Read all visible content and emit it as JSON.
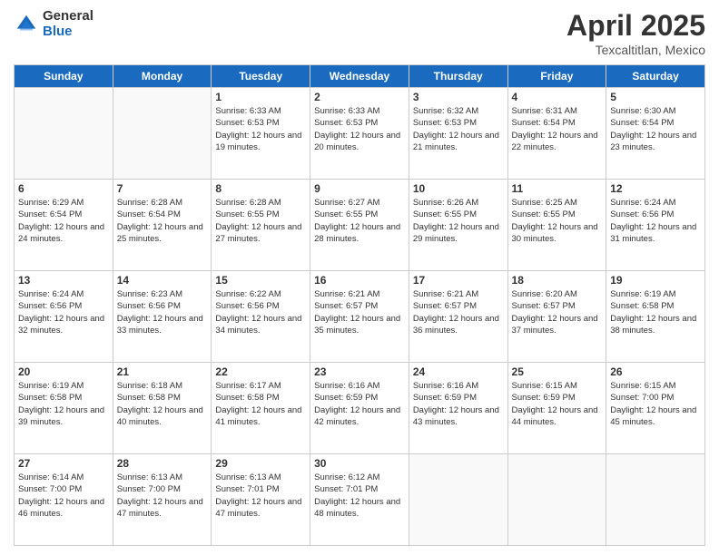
{
  "header": {
    "logo_general": "General",
    "logo_blue": "Blue",
    "month_title": "April 2025",
    "location": "Texcaltitlan, Mexico"
  },
  "weekdays": [
    "Sunday",
    "Monday",
    "Tuesday",
    "Wednesday",
    "Thursday",
    "Friday",
    "Saturday"
  ],
  "weeks": [
    [
      {
        "day": "",
        "info": ""
      },
      {
        "day": "",
        "info": ""
      },
      {
        "day": "1",
        "sunrise": "6:33 AM",
        "sunset": "6:53 PM",
        "daylight": "12 hours and 19 minutes."
      },
      {
        "day": "2",
        "sunrise": "6:33 AM",
        "sunset": "6:53 PM",
        "daylight": "12 hours and 20 minutes."
      },
      {
        "day": "3",
        "sunrise": "6:32 AM",
        "sunset": "6:53 PM",
        "daylight": "12 hours and 21 minutes."
      },
      {
        "day": "4",
        "sunrise": "6:31 AM",
        "sunset": "6:54 PM",
        "daylight": "12 hours and 22 minutes."
      },
      {
        "day": "5",
        "sunrise": "6:30 AM",
        "sunset": "6:54 PM",
        "daylight": "12 hours and 23 minutes."
      }
    ],
    [
      {
        "day": "6",
        "sunrise": "6:29 AM",
        "sunset": "6:54 PM",
        "daylight": "12 hours and 24 minutes."
      },
      {
        "day": "7",
        "sunrise": "6:28 AM",
        "sunset": "6:54 PM",
        "daylight": "12 hours and 25 minutes."
      },
      {
        "day": "8",
        "sunrise": "6:28 AM",
        "sunset": "6:55 PM",
        "daylight": "12 hours and 27 minutes."
      },
      {
        "day": "9",
        "sunrise": "6:27 AM",
        "sunset": "6:55 PM",
        "daylight": "12 hours and 28 minutes."
      },
      {
        "day": "10",
        "sunrise": "6:26 AM",
        "sunset": "6:55 PM",
        "daylight": "12 hours and 29 minutes."
      },
      {
        "day": "11",
        "sunrise": "6:25 AM",
        "sunset": "6:55 PM",
        "daylight": "12 hours and 30 minutes."
      },
      {
        "day": "12",
        "sunrise": "6:24 AM",
        "sunset": "6:56 PM",
        "daylight": "12 hours and 31 minutes."
      }
    ],
    [
      {
        "day": "13",
        "sunrise": "6:24 AM",
        "sunset": "6:56 PM",
        "daylight": "12 hours and 32 minutes."
      },
      {
        "day": "14",
        "sunrise": "6:23 AM",
        "sunset": "6:56 PM",
        "daylight": "12 hours and 33 minutes."
      },
      {
        "day": "15",
        "sunrise": "6:22 AM",
        "sunset": "6:56 PM",
        "daylight": "12 hours and 34 minutes."
      },
      {
        "day": "16",
        "sunrise": "6:21 AM",
        "sunset": "6:57 PM",
        "daylight": "12 hours and 35 minutes."
      },
      {
        "day": "17",
        "sunrise": "6:21 AM",
        "sunset": "6:57 PM",
        "daylight": "12 hours and 36 minutes."
      },
      {
        "day": "18",
        "sunrise": "6:20 AM",
        "sunset": "6:57 PM",
        "daylight": "12 hours and 37 minutes."
      },
      {
        "day": "19",
        "sunrise": "6:19 AM",
        "sunset": "6:58 PM",
        "daylight": "12 hours and 38 minutes."
      }
    ],
    [
      {
        "day": "20",
        "sunrise": "6:19 AM",
        "sunset": "6:58 PM",
        "daylight": "12 hours and 39 minutes."
      },
      {
        "day": "21",
        "sunrise": "6:18 AM",
        "sunset": "6:58 PM",
        "daylight": "12 hours and 40 minutes."
      },
      {
        "day": "22",
        "sunrise": "6:17 AM",
        "sunset": "6:58 PM",
        "daylight": "12 hours and 41 minutes."
      },
      {
        "day": "23",
        "sunrise": "6:16 AM",
        "sunset": "6:59 PM",
        "daylight": "12 hours and 42 minutes."
      },
      {
        "day": "24",
        "sunrise": "6:16 AM",
        "sunset": "6:59 PM",
        "daylight": "12 hours and 43 minutes."
      },
      {
        "day": "25",
        "sunrise": "6:15 AM",
        "sunset": "6:59 PM",
        "daylight": "12 hours and 44 minutes."
      },
      {
        "day": "26",
        "sunrise": "6:15 AM",
        "sunset": "7:00 PM",
        "daylight": "12 hours and 45 minutes."
      }
    ],
    [
      {
        "day": "27",
        "sunrise": "6:14 AM",
        "sunset": "7:00 PM",
        "daylight": "12 hours and 46 minutes."
      },
      {
        "day": "28",
        "sunrise": "6:13 AM",
        "sunset": "7:00 PM",
        "daylight": "12 hours and 47 minutes."
      },
      {
        "day": "29",
        "sunrise": "6:13 AM",
        "sunset": "7:01 PM",
        "daylight": "12 hours and 47 minutes."
      },
      {
        "day": "30",
        "sunrise": "6:12 AM",
        "sunset": "7:01 PM",
        "daylight": "12 hours and 48 minutes."
      },
      {
        "day": "",
        "info": ""
      },
      {
        "day": "",
        "info": ""
      },
      {
        "day": "",
        "info": ""
      }
    ]
  ]
}
